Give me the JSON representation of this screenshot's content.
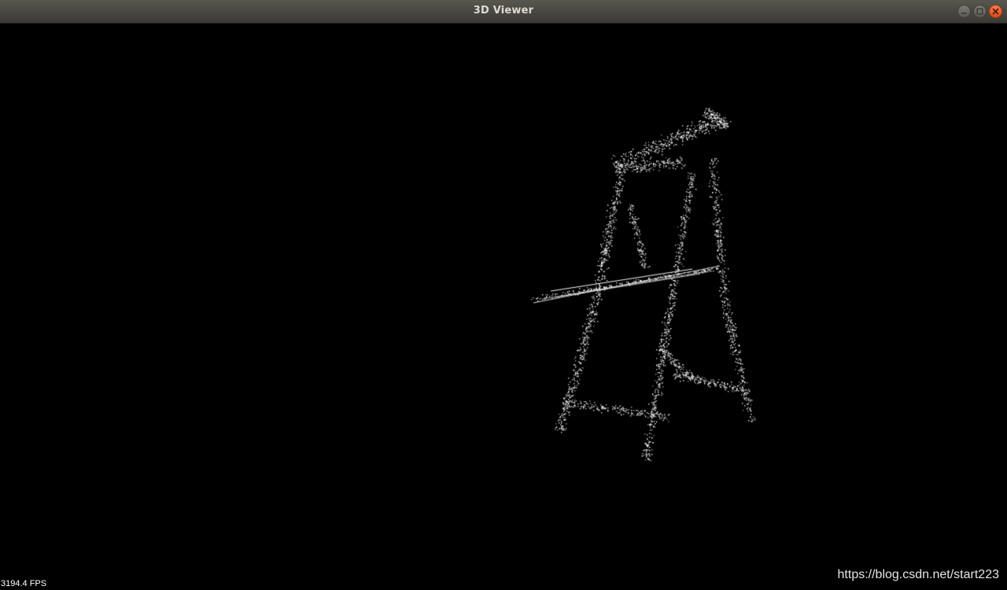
{
  "window": {
    "title": "3D Viewer",
    "controls": {
      "minimize_icon": "minimize-icon",
      "maximize_icon": "maximize-icon",
      "close_icon": "close-icon"
    }
  },
  "viewer": {
    "background_color": "#000000",
    "point_color": "#ffffff",
    "fps_text": "3194.4 FPS"
  },
  "watermark": {
    "text": "https://blog.csdn.net/start223"
  }
}
